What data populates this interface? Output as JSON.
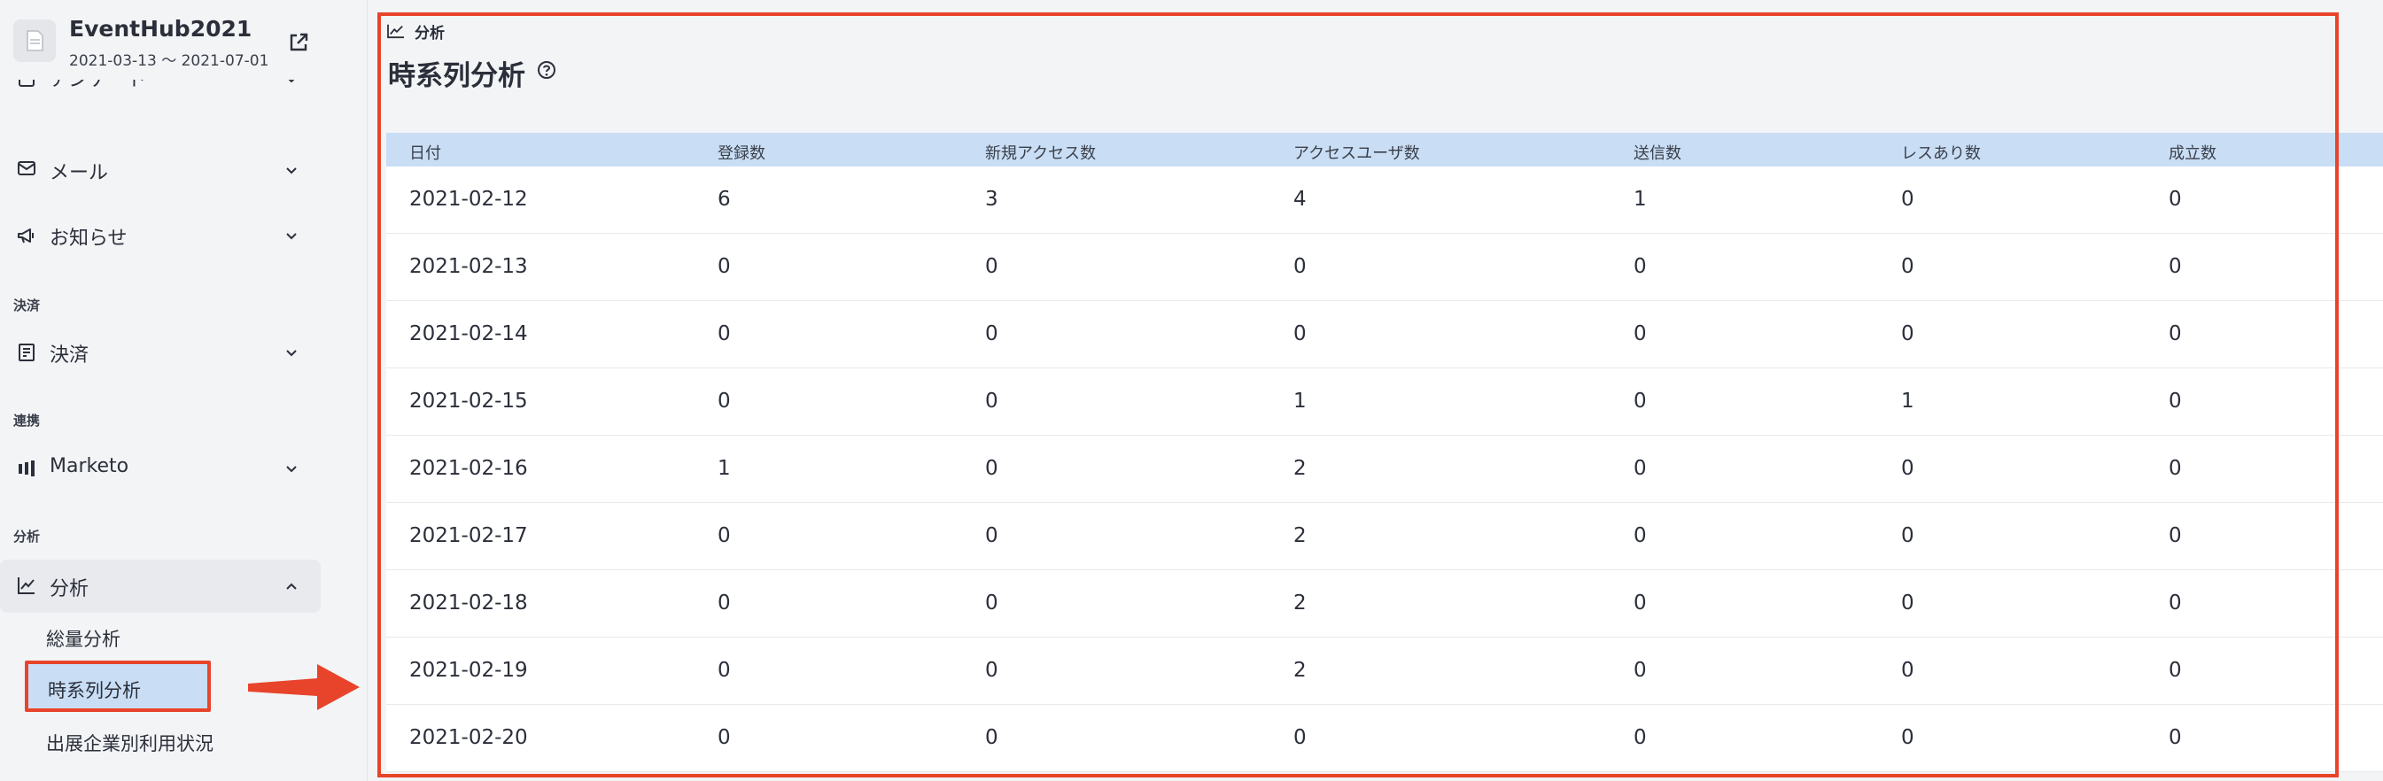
{
  "event": {
    "name": "EventHub2021",
    "dates": "2021-03-13 〜 2021-07-01"
  },
  "sidebar": {
    "items": [
      {
        "label": "アンケート",
        "icon": "clipboard-icon"
      },
      {
        "label": "メール",
        "icon": "mail-icon"
      },
      {
        "label": "お知らせ",
        "icon": "megaphone-icon"
      }
    ],
    "sections": {
      "payment": {
        "heading": "決済",
        "item": "決済",
        "icon": "receipt-icon"
      },
      "integration": {
        "heading": "連携",
        "item": "Marketo",
        "icon": "marketo-icon"
      },
      "analysis": {
        "heading": "分析",
        "item": "分析",
        "icon": "chart-icon",
        "subitems": [
          "総量分析",
          "時系列分析",
          "出展企業別利用状況"
        ],
        "active_subitem": "時系列分析"
      }
    }
  },
  "main": {
    "breadcrumb": "分析",
    "title": "時系列分析",
    "table": {
      "headers": [
        "日付",
        "登録数",
        "新規アクセス数",
        "アクセスユーザ数",
        "送信数",
        "レスあり数",
        "成立数"
      ],
      "rows": [
        [
          "2021-02-12",
          "6",
          "3",
          "4",
          "1",
          "0",
          "0"
        ],
        [
          "2021-02-13",
          "0",
          "0",
          "0",
          "0",
          "0",
          "0"
        ],
        [
          "2021-02-14",
          "0",
          "0",
          "0",
          "0",
          "0",
          "0"
        ],
        [
          "2021-02-15",
          "0",
          "0",
          "1",
          "0",
          "1",
          "0"
        ],
        [
          "2021-02-16",
          "1",
          "0",
          "2",
          "0",
          "0",
          "0"
        ],
        [
          "2021-02-17",
          "0",
          "0",
          "2",
          "0",
          "0",
          "0"
        ],
        [
          "2021-02-18",
          "0",
          "0",
          "2",
          "0",
          "0",
          "0"
        ],
        [
          "2021-02-19",
          "0",
          "0",
          "2",
          "0",
          "0",
          "0"
        ],
        [
          "2021-02-20",
          "0",
          "0",
          "0",
          "0",
          "0",
          "0"
        ]
      ]
    }
  },
  "colors": {
    "accent_red": "#e8442b",
    "header_blue": "#c9def5",
    "sidebar_bg": "#f3f4f6"
  }
}
